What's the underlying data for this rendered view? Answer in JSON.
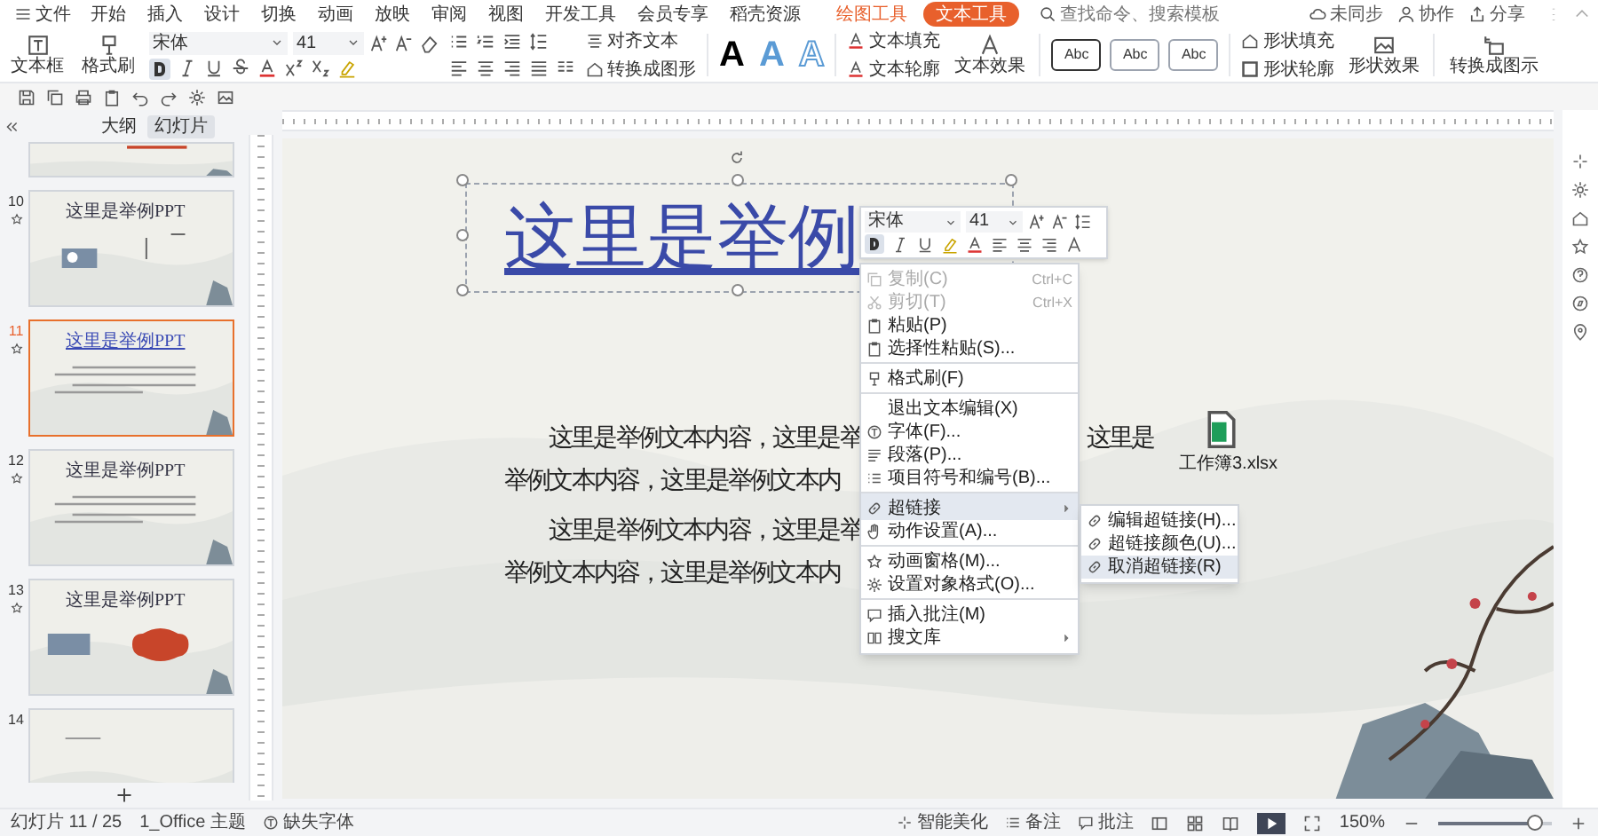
{
  "menu_tabs": [
    {
      "label": "文件",
      "kind": "file",
      "selected": false
    },
    {
      "label": "开始",
      "kind": "tab",
      "selected": false
    },
    {
      "label": "插入",
      "kind": "tab",
      "selected": false
    },
    {
      "label": "设计",
      "kind": "tab",
      "selected": false
    },
    {
      "label": "切换",
      "kind": "tab",
      "selected": false
    },
    {
      "label": "动画",
      "kind": "tab",
      "selected": false
    },
    {
      "label": "放映",
      "kind": "tab",
      "selected": false
    },
    {
      "label": "审阅",
      "kind": "tab",
      "selected": false
    },
    {
      "label": "视图",
      "kind": "tab",
      "selected": false
    },
    {
      "label": "开发工具",
      "kind": "tab",
      "selected": false
    },
    {
      "label": "会员专享",
      "kind": "tab",
      "selected": false
    },
    {
      "label": "稻壳资源",
      "kind": "tab",
      "selected": false
    },
    {
      "label": "绘图工具",
      "kind": "tool",
      "selected": false
    },
    {
      "label": "文本工具",
      "kind": "tool",
      "selected": true
    }
  ],
  "search": {
    "placeholder": "查找命令、搜索模板"
  },
  "account_actions": [
    "未同步",
    "协作",
    "分享"
  ],
  "ribbon": {
    "text_box": "文本框",
    "format_painter": "格式刷",
    "font": "宋体",
    "font_size": "41",
    "bold": true,
    "align_text": "对齐文本",
    "convert_shape": "转换成图形",
    "wordart": [
      "A",
      "A",
      "A"
    ],
    "text_fill": "文本填充",
    "text_outline": "文本轮廓",
    "text_effect": "文本效果",
    "shape_styles": [
      {
        "label": "Abc",
        "selected": true
      },
      {
        "label": "Abc",
        "selected": false
      },
      {
        "label": "Abc",
        "selected": false
      }
    ],
    "shape_fill": "形状填充",
    "shape_outline": "形状轮廓",
    "shape_effect": "形状效果",
    "convert_diagram": "转换成图示"
  },
  "panel_tabs": [
    {
      "label": "大纲",
      "selected": false
    },
    {
      "label": "幻灯片",
      "selected": true
    }
  ],
  "slides": [
    {
      "kind": "partial",
      "selected": false,
      "starred": false
    },
    {
      "number": "10",
      "title": "这里是举例PPT",
      "kind": "images",
      "selected": false,
      "starred": true
    },
    {
      "number": "11",
      "title": "这里是举例PPT",
      "kind": "text",
      "selected": true,
      "starred": true
    },
    {
      "number": "12",
      "title": "这里是举例PPT",
      "kind": "text",
      "selected": false,
      "starred": true
    },
    {
      "number": "13",
      "title": "这里是举例PPT",
      "kind": "logo",
      "selected": false,
      "starred": true
    },
    {
      "number": "14",
      "kind": "shapes",
      "selected": false,
      "starred": false
    }
  ],
  "slide": {
    "title": "这里是举例",
    "lines": [
      {
        "kind": "first",
        "left": "这里是举例文本内容，这里是举",
        "right": "这里是"
      },
      {
        "kind": "cont",
        "left": "举例文本内容，这里是举例文本内"
      },
      {
        "kind": "first",
        "left": "这里是举例文本内容，这里是举"
      },
      {
        "kind": "cont",
        "left": "举例文本内容，这里是举例文本内"
      }
    ],
    "file_label": "工作簿3.xlsx"
  },
  "mini_toolbar": {
    "font": "宋体",
    "font_size": "41",
    "bold": true
  },
  "context_menu": [
    {
      "label": "复制(C)",
      "shortcut": "Ctrl+C",
      "disabled": true,
      "separator_before": false,
      "submenu": false,
      "selected": false
    },
    {
      "label": "剪切(T)",
      "shortcut": "Ctrl+X",
      "disabled": true,
      "separator_before": false,
      "submenu": false,
      "selected": false
    },
    {
      "label": "粘贴(P)",
      "disabled": false,
      "separator_before": false,
      "submenu": false,
      "selected": false
    },
    {
      "label": "选择性粘贴(S)...",
      "disabled": false,
      "separator_before": false,
      "submenu": false,
      "selected": false
    },
    {
      "label": "格式刷(F)",
      "disabled": false,
      "separator_before": true,
      "submenu": false,
      "selected": false
    },
    {
      "label": "退出文本编辑(X)",
      "disabled": false,
      "separator_before": true,
      "submenu": false,
      "selected": false
    },
    {
      "label": "字体(F)...",
      "disabled": false,
      "separator_before": false,
      "submenu": false,
      "selected": false
    },
    {
      "label": "段落(P)...",
      "disabled": false,
      "separator_before": false,
      "submenu": false,
      "selected": false
    },
    {
      "label": "项目符号和编号(B)...",
      "disabled": false,
      "separator_before": false,
      "submenu": false,
      "selected": false
    },
    {
      "label": "超链接",
      "disabled": false,
      "separator_before": true,
      "submenu": true,
      "selected": true
    },
    {
      "label": "动作设置(A)...",
      "disabled": false,
      "separator_before": false,
      "submenu": false,
      "selected": false
    },
    {
      "label": "动画窗格(M)...",
      "disabled": false,
      "separator_before": true,
      "submenu": false,
      "selected": false
    },
    {
      "label": "设置对象格式(O)...",
      "disabled": false,
      "separator_before": false,
      "submenu": false,
      "selected": false
    },
    {
      "label": "插入批注(M)",
      "disabled": false,
      "separator_before": true,
      "submenu": false,
      "selected": false
    },
    {
      "label": "搜文库",
      "disabled": false,
      "separator_before": false,
      "submenu": true,
      "selected": false
    }
  ],
  "submenu": [
    {
      "label": "编辑超链接(H)...",
      "selected": false
    },
    {
      "label": "超链接颜色(U)...",
      "selected": false
    },
    {
      "label": "取消超链接(R)",
      "selected": true
    }
  ],
  "status_bar": {
    "slide_count": "幻灯片 11 / 25",
    "theme": "1_Office 主题",
    "missing_font": "缺失字体",
    "beautify": "智能美化",
    "notes": "备注",
    "comments": "批注",
    "zoom": "150%",
    "zoom_slider": {
      "level": 0.85
    }
  }
}
